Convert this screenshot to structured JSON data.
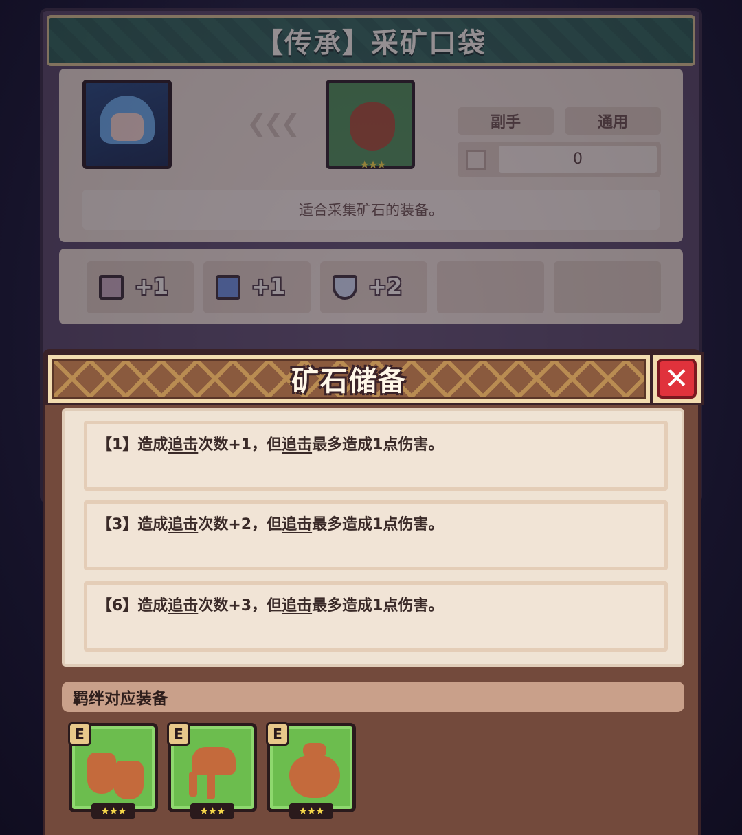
{
  "item_card": {
    "title": "【传承】采矿口袋",
    "tags": [
      "副手",
      "通用"
    ],
    "count_value": "0",
    "description": "适合采集矿石的装备。",
    "stats": [
      {
        "icon": "scroll-icon",
        "value": "+1"
      },
      {
        "icon": "boot-icon",
        "value": "+1"
      },
      {
        "icon": "shield-icon",
        "value": "+2"
      }
    ]
  },
  "popup": {
    "title": "矿石储备",
    "close_symbol": "✕",
    "effects": [
      {
        "prefix": "【1】造成",
        "kw1": "追击",
        "mid": "次数+1，但",
        "kw2": "追击",
        "suffix": "最多造成1点伤害。"
      },
      {
        "prefix": "【3】造成",
        "kw1": "追击",
        "mid": "次数+2，但",
        "kw2": "追击",
        "suffix": "最多造成1点伤害。"
      },
      {
        "prefix": "【6】造成",
        "kw1": "追击",
        "mid": "次数+3，但",
        "kw2": "追击",
        "suffix": "最多造成1点伤害。"
      }
    ],
    "bond_label": "羁绊对应装备",
    "bond_items": [
      {
        "icon": "boots-icon",
        "grade": "E",
        "stars": "★★★"
      },
      {
        "icon": "glove-icon",
        "grade": "E",
        "stars": "★★★"
      },
      {
        "icon": "sack-icon",
        "grade": "E",
        "stars": "★★★"
      }
    ]
  },
  "colors": {
    "popup_bg": "#734a3c",
    "close_red": "#e0323c",
    "item_green": "#6cbd4e",
    "star_gold": "#f6d84a"
  }
}
